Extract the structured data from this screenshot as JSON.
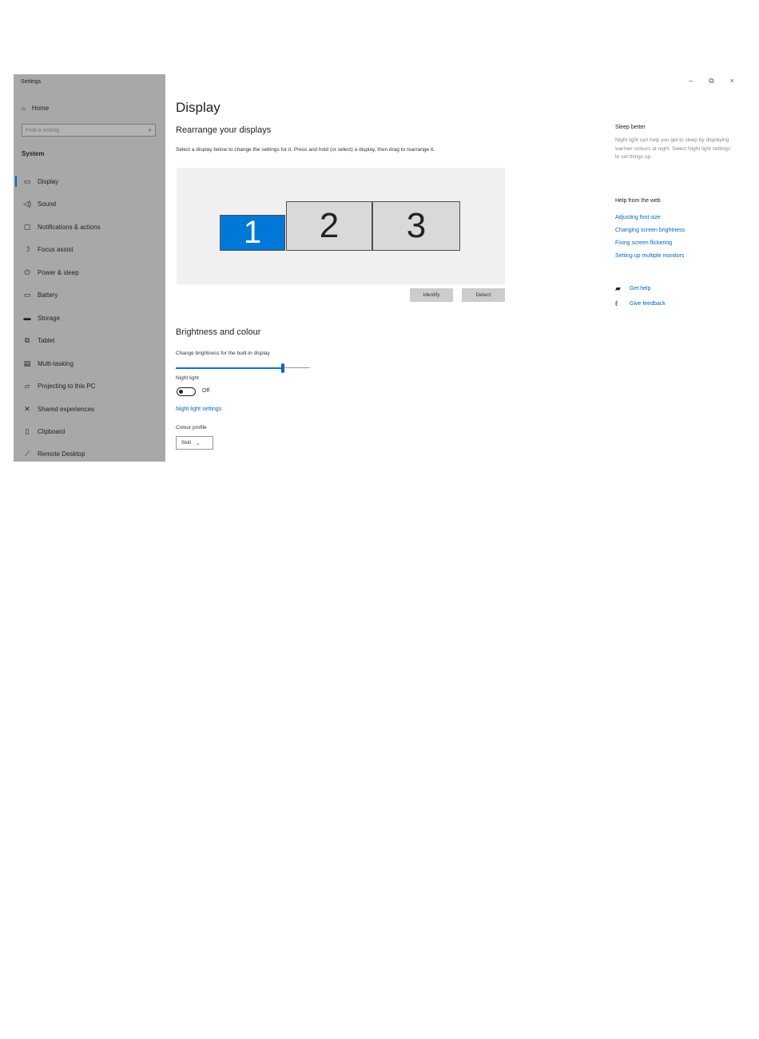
{
  "window": {
    "title": "Settings",
    "controls": {
      "minimize": "–",
      "restore": "⧉",
      "close": "×"
    }
  },
  "sidebar": {
    "home": {
      "icon": "home-icon",
      "label": "Home"
    },
    "search_placeholder": "Find a setting",
    "section": "System",
    "items": [
      {
        "icon": "monitor-icon",
        "label": "Display",
        "active": true
      },
      {
        "icon": "speaker-icon",
        "label": "Sound"
      },
      {
        "icon": "notification-icon",
        "label": "Notifications & actions"
      },
      {
        "icon": "moon-icon",
        "label": "Focus assist"
      },
      {
        "icon": "power-icon",
        "label": "Power & sleep"
      },
      {
        "icon": "battery-icon",
        "label": "Battery"
      },
      {
        "icon": "storage-icon",
        "label": "Storage"
      },
      {
        "icon": "tablet-icon",
        "label": "Tablet"
      },
      {
        "icon": "multitasking-icon",
        "label": "Multi-tasking"
      },
      {
        "icon": "projecting-icon",
        "label": "Projecting to this PC"
      },
      {
        "icon": "shared-icon",
        "label": "Shared experiences"
      },
      {
        "icon": "clipboard-icon",
        "label": "Clipboard"
      },
      {
        "icon": "remote-desktop-icon",
        "label": "Remote Desktop"
      }
    ]
  },
  "main": {
    "title": "Display",
    "rearrange": {
      "heading": "Rearrange your displays",
      "description": "Select a display below to change the settings for it. Press and hold (or select) a display, then drag to rearrange it.",
      "monitors": [
        {
          "label": "1",
          "selected": true
        },
        {
          "label": "2",
          "selected": false
        },
        {
          "label": "3",
          "selected": false
        }
      ],
      "identify_label": "Identify",
      "detect_label": "Detect"
    },
    "brightness": {
      "heading": "Brightness and colour",
      "slider_label": "Change brightness for the built-in display",
      "value_percent": 80,
      "night_light_label": "Night light",
      "night_light_state": "Off",
      "night_light_settings": "Night light settings",
      "colour_profile_label": "Colour profile",
      "colour_profile_value": "Skill"
    }
  },
  "right_panel": {
    "sleep_heading": "Sleep better",
    "sleep_text": "Night light can help you get to sleep by displaying warmer colours at night. Select Night light settings to set things up.",
    "help_heading": "Help from the web",
    "links": [
      "Adjusting font size",
      "Changing screen brightness",
      "Fixing screen flickering",
      "Setting up multiple monitors"
    ],
    "get_help": {
      "icon": "chat-help-icon",
      "label": "Get help"
    },
    "feedback": {
      "icon": "feedback-icon",
      "label": "Give feedback"
    }
  },
  "colors": {
    "accent": "#0078d7",
    "sidebar_bg": "#a8a8a8",
    "link": "#0067c0"
  }
}
